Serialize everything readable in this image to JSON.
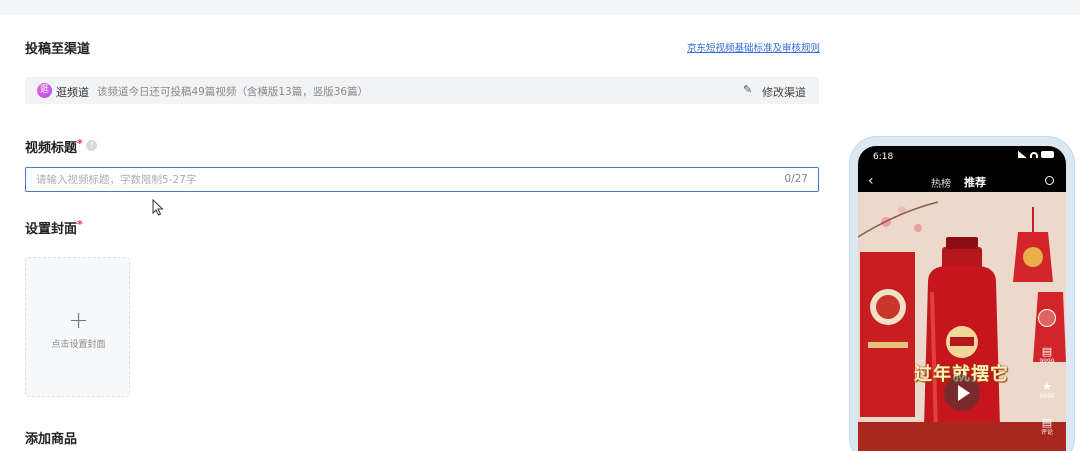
{
  "channel_section": {
    "title": "投稿至渠道",
    "rules_link": "京东短视频基础标准及审核规则",
    "channel_logo": "逛",
    "channel_name": "逛频道",
    "quota_text": "该频道今日还可投稿49篇视频（含横版13篇，竖版36篇）",
    "modify_label": "修改渠道",
    "modify_icon": "pencil-icon"
  },
  "video_title": {
    "label": "视频标题",
    "required_mark": "*",
    "help_icon": "question-circle-icon",
    "value": "",
    "placeholder": "请输入视频标题，字数限制5-27字",
    "counter": "0/27"
  },
  "cover": {
    "label": "设置封面",
    "required_mark": "*",
    "plus_icon": "plus-icon",
    "button_label": "点击设置封面"
  },
  "products": {
    "label": "添加商品"
  },
  "preview": {
    "status_time": "6:18",
    "tab_hot": "热榜",
    "tab_recommend": "推荐",
    "overlay_text": "过年就摆它",
    "actions": [
      {
        "icon": "comment-icon",
        "count": "9999"
      },
      {
        "icon": "star-icon",
        "count": "9999"
      },
      {
        "icon": "comment-icon",
        "count": "评论"
      }
    ]
  },
  "colors": {
    "accent": "#2f6bd8",
    "required": "#e33333",
    "input_border": "#4a78c8"
  }
}
